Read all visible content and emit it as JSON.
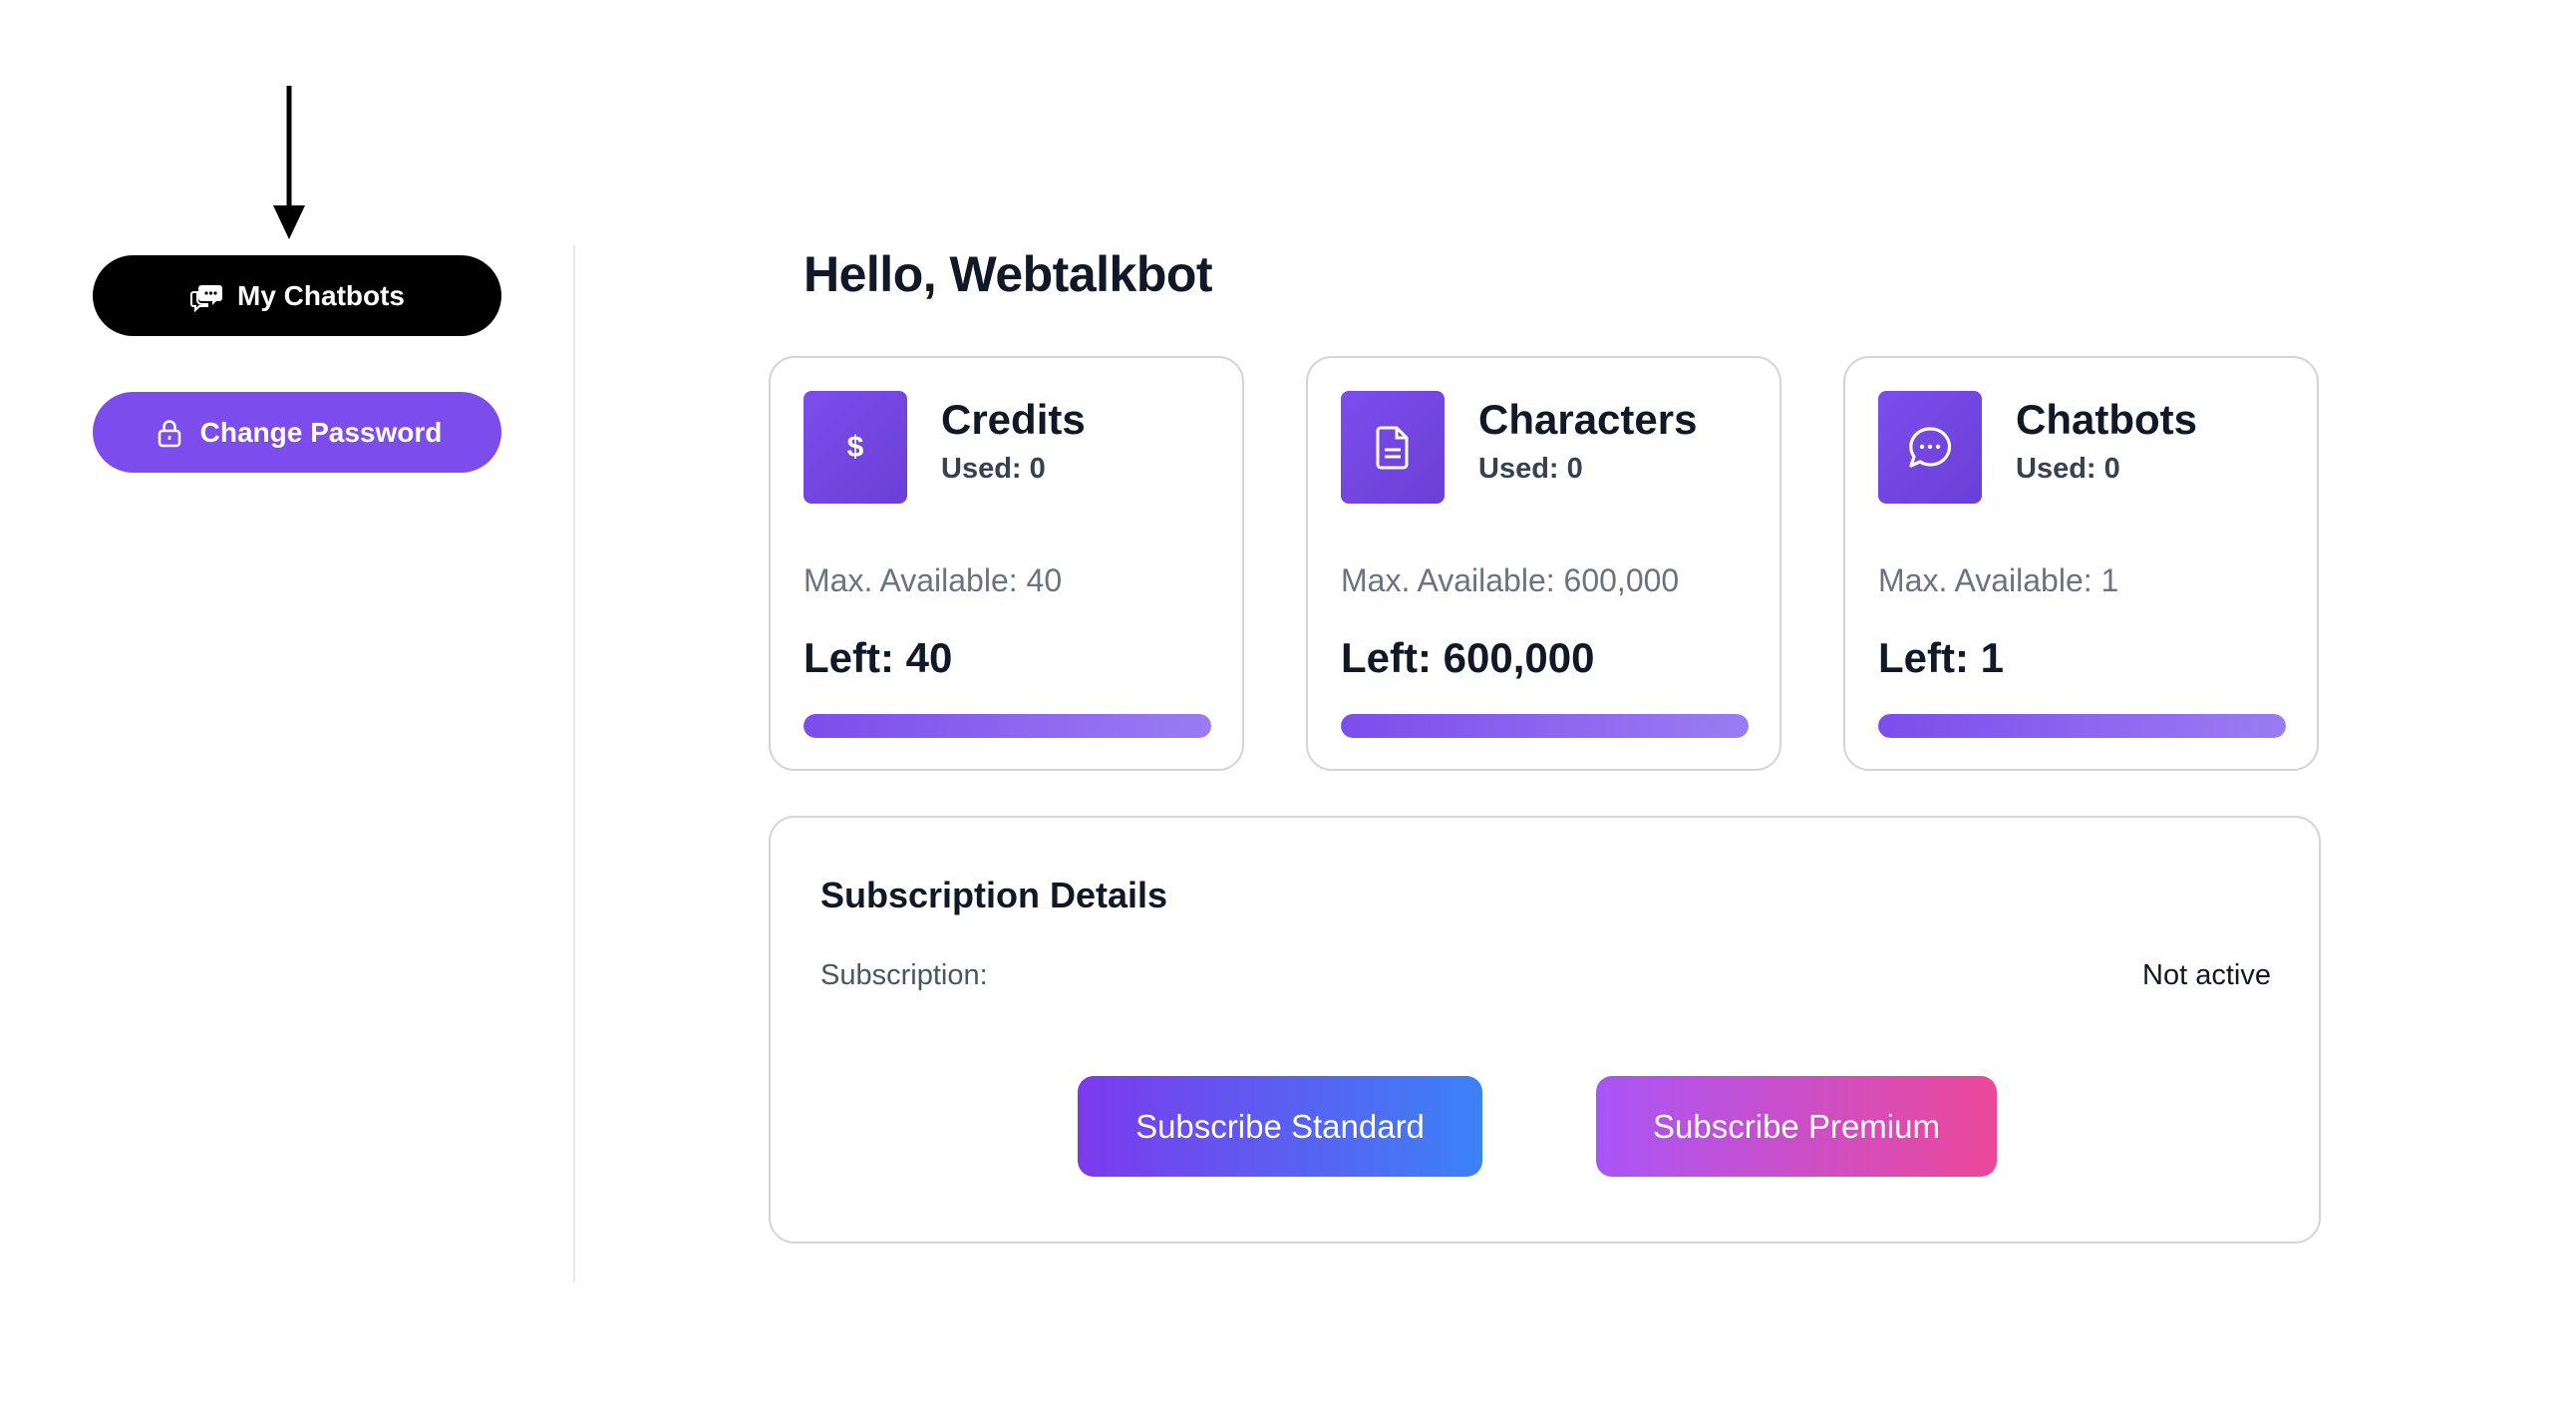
{
  "sidebar": {
    "items": [
      {
        "label": "My Chatbots",
        "icon": "chat-bubbles-icon"
      },
      {
        "label": "Change Password",
        "icon": "lock-icon"
      }
    ]
  },
  "main": {
    "greeting": "Hello, Webtalkbot",
    "cards": [
      {
        "icon": "dollar-icon",
        "title": "Credits",
        "used": "Used: 0",
        "max": "Max. Available: 40",
        "left": "Left: 40",
        "remaining_fraction": 1.0
      },
      {
        "icon": "document-icon",
        "title": "Characters",
        "used": "Used: 0",
        "max": "Max. Available: 600,000",
        "left": "Left: 600,000",
        "remaining_fraction": 1.0
      },
      {
        "icon": "message-bubble-icon",
        "title": "Chatbots",
        "used": "Used: 0",
        "max": "Max. Available: 1",
        "left": "Left: 1",
        "remaining_fraction": 1.0
      }
    ],
    "subscription": {
      "title": "Subscription Details",
      "label": "Subscription:",
      "status": "Not active",
      "standard_button": "Subscribe Standard",
      "premium_button": "Subscribe Premium"
    }
  },
  "colors": {
    "accent": "#7c4dec",
    "nav_active": "#000000",
    "standard_gradient": [
      "#7c3aed",
      "#3b82f6"
    ],
    "premium_gradient": [
      "#a855f7",
      "#ec4899"
    ]
  }
}
